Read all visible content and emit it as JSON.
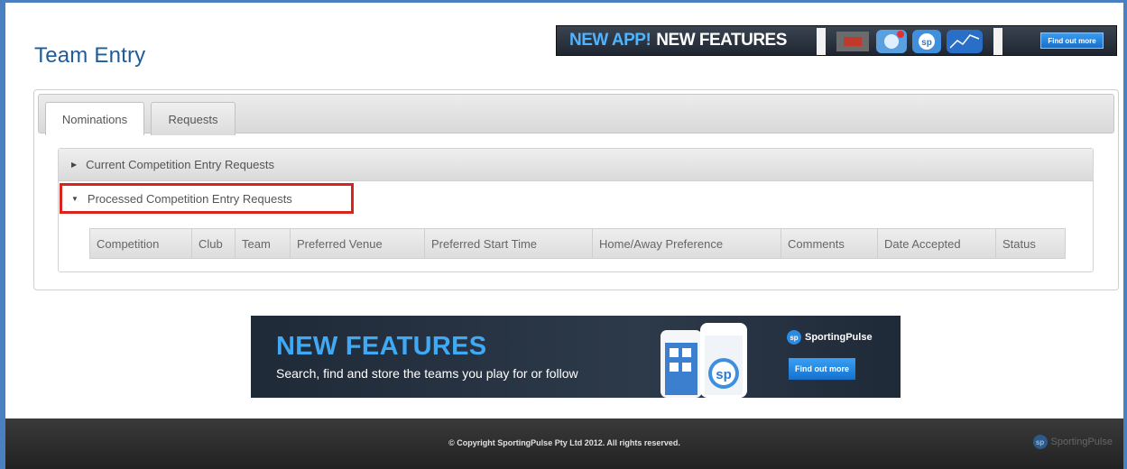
{
  "page": {
    "title": "Team Entry"
  },
  "top_banner": {
    "headline_highlight": "NEW APP!",
    "headline": "NEW FEATURES",
    "button_label": "Find out more"
  },
  "tabs": [
    {
      "label": "Nominations",
      "active": true
    },
    {
      "label": "Requests",
      "active": false
    }
  ],
  "sections": {
    "current": {
      "label": "Current Competition Entry Requests",
      "expanded": false
    },
    "processed": {
      "label": "Processed Competition Entry Requests",
      "expanded": true
    }
  },
  "table": {
    "columns": [
      "Competition",
      "Club",
      "Team",
      "Preferred Venue",
      "Preferred Start Time",
      "Home/Away Preference",
      "Comments",
      "Date Accepted",
      "Status"
    ]
  },
  "bottom_banner": {
    "headline": "NEW FEATURES",
    "subtext": "Search, find and store the teams you play for or follow",
    "brand": "SportingPulse",
    "button_label": "Find out more"
  },
  "footer": {
    "copyright": "©  Copyright SportingPulse Pty Ltd  2012.  All rights reserved.",
    "logo_text": "SportingPulse"
  },
  "colors": {
    "title": "#1f5c9a",
    "highlight_border": "#d9241d",
    "accent_blue": "#3fa9f5"
  },
  "icons": {
    "collapsed": "triangle-right-icon",
    "expanded": "triangle-down-icon"
  }
}
